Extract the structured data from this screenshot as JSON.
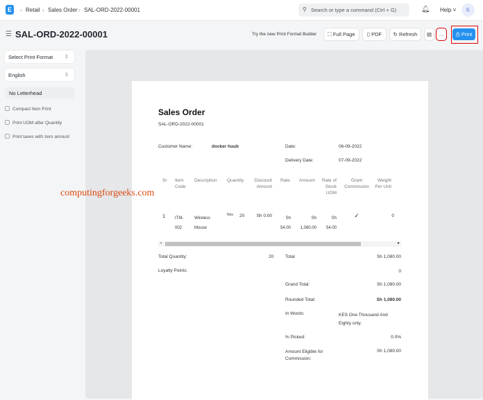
{
  "nav": {
    "logo": "E",
    "breadcrumbs": [
      "Retail",
      "Sales Order",
      "SAL-ORD-2022-00001"
    ],
    "search_placeholder": "Search or type a command (Ctrl + G)",
    "help": "Help",
    "avatar": "K"
  },
  "header": {
    "title": "SAL-ORD-2022-00001",
    "builder_link": "Try the new Print Format Builder",
    "full_page": "Full Page",
    "pdf": "PDF",
    "refresh": "Refresh",
    "more": "...",
    "print": "Print"
  },
  "sidebar": {
    "print_format": "Select Print Format",
    "language": "English",
    "letterhead": "No Letterhead",
    "options": [
      "Compact Item Print",
      "Print UOM after Quantity",
      "Print taxes with zero amount"
    ]
  },
  "watermark": "computingforgeeks.com",
  "doc": {
    "title": "Sales Order",
    "number": "SAL-ORD-2022-00001",
    "customer_label": "Customer Name:",
    "customer": "docker huub",
    "date_label": "Date:",
    "date": "06-09-2022",
    "delivery_label": "Delivery Date:",
    "delivery": "07-09-2022",
    "columns": [
      "Sr",
      "Item Code",
      "Description",
      "Quantity",
      "Discount Amount",
      "Rate",
      "Amount",
      "Rate of Stock UOM",
      "Grant Commission",
      "Weight Per Unit"
    ],
    "row": {
      "sr": "1",
      "item_code": "ITM-002",
      "description": "Wireless Mouse",
      "uom": "Nos",
      "qty": "20",
      "discount": "Sh 0.00",
      "rate": "Sh 54.00",
      "amount": "Sh 1,080.00",
      "rate_stock": "Sh 54.00",
      "grant": "✓",
      "weight": "0"
    },
    "total_qty_label": "Total Quantity:",
    "total_qty": "20",
    "loyalty_label": "Loyalty Points:",
    "total_label": "Total",
    "total": "Sh 1,080.00",
    "zero": "0",
    "grand_label": "Grand Total:",
    "grand": "Sh 1,080.00",
    "rounded_label": "Rounded Total:",
    "rounded": "Sh 1,080.00",
    "words_label": "In Words:",
    "words": "KES One Thousand And Eighty only.",
    "picked_label": "% Picked:",
    "picked": "0.0%",
    "commission_label": "Amount Eligible for Commission:",
    "commission": "Sh 1,080.00"
  }
}
